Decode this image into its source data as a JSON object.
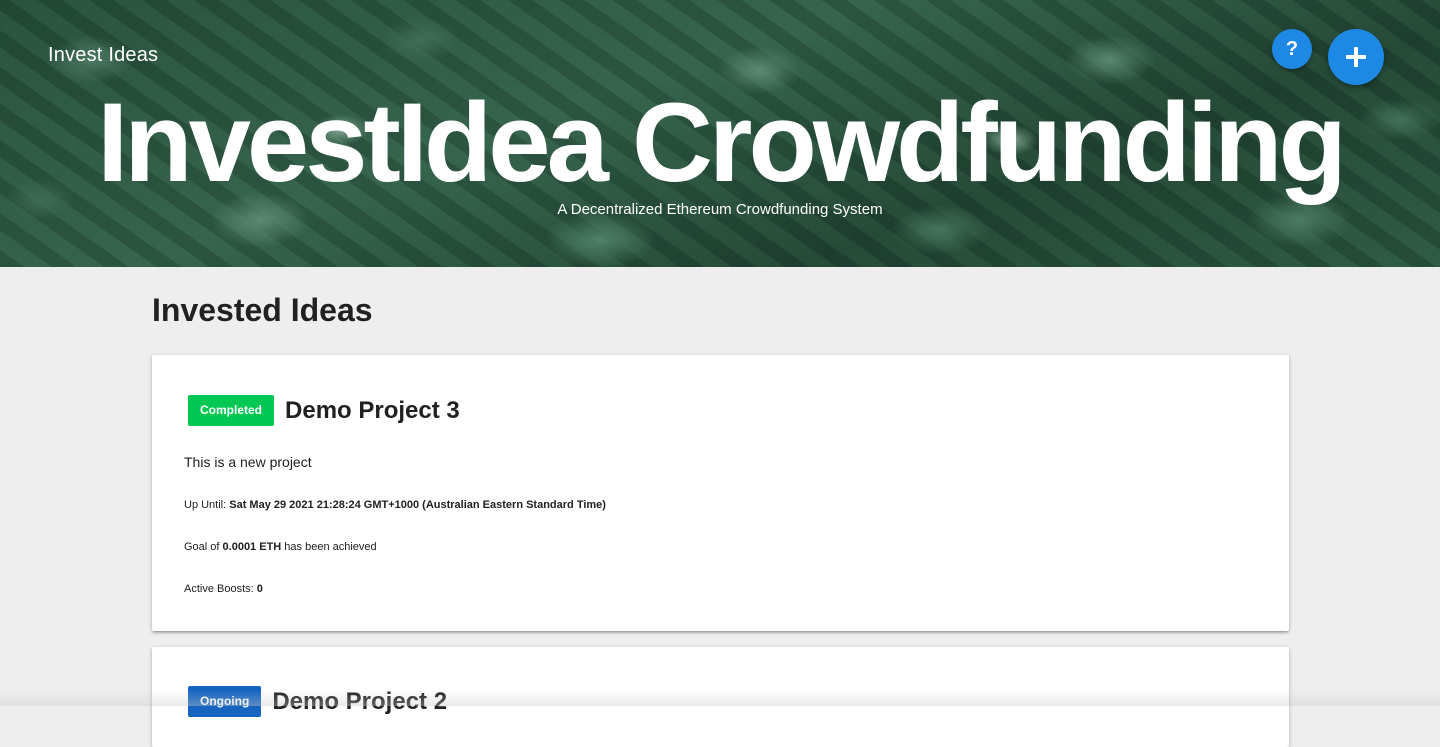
{
  "header": {
    "brand": "Invest Ideas",
    "title": "InvestIdea Crowdfunding",
    "subtitle": "A Decentralized Ethereum Crowdfunding System",
    "help_label": "?",
    "add_icon": "plus-icon"
  },
  "main": {
    "section_title": "Invested Ideas",
    "projects": [
      {
        "status": "Completed",
        "status_color": "#00c853",
        "name": "Demo Project 3",
        "description": "This is a new project",
        "until_label": "Up Until:",
        "until_value": "Sat May 29 2021 21:28:24 GMT+1000 (Australian Eastern Standard Time)",
        "goal_prefix": "Goal of",
        "goal_value": "0.0001 ETH",
        "goal_suffix": "has been achieved",
        "boosts_label": "Active Boosts:",
        "boosts_value": "0"
      },
      {
        "status": "Ongoing",
        "status_color": "#1565c0",
        "name": "Demo Project 2"
      }
    ]
  },
  "colors": {
    "accent": "#1e88e5",
    "background": "#eeeeee"
  }
}
